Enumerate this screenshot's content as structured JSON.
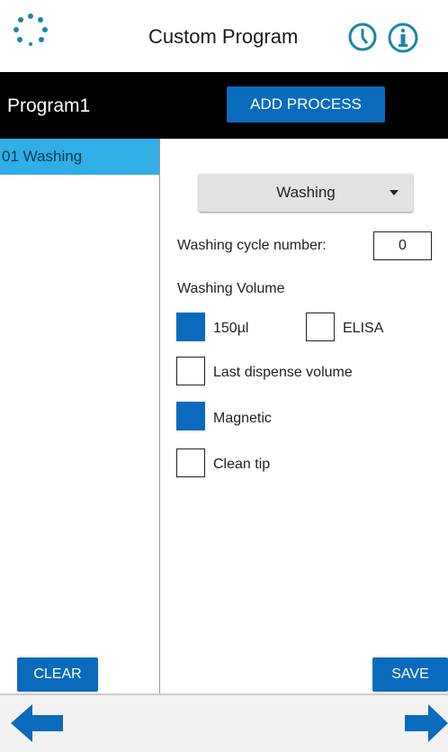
{
  "top": {
    "title": "Custom Program",
    "logo_icon": "dotted-circle-icon",
    "clock_icon": "clock-icon",
    "info_icon": "info-icon"
  },
  "header": {
    "program_name": "Program1",
    "add_process_label": "ADD PROCESS"
  },
  "sidebar": {
    "items": [
      {
        "label": "01 Washing"
      }
    ],
    "clear_label": "CLEAR"
  },
  "main": {
    "process_type": "Washing",
    "cycle_label": "Washing cycle number:",
    "cycle_value": "0",
    "volume_label": "Washing Volume",
    "options": {
      "vol150": {
        "label": "150µl",
        "checked": true
      },
      "elisa": {
        "label": "ELISA",
        "checked": false
      },
      "last_dispense": {
        "label": "Last dispense volume",
        "checked": false
      },
      "magnetic": {
        "label": "Magnetic",
        "checked": true
      },
      "clean_tip": {
        "label": "Clean tip",
        "checked": false
      }
    },
    "save_label": "SAVE"
  },
  "nav": {
    "left_icon": "arrow-left-icon",
    "right_icon": "arrow-right-icon"
  },
  "colors": {
    "accent": "#0a6bbd",
    "selected": "#30aee6",
    "header": "#000000",
    "icon_teal": "#1a86a8"
  }
}
